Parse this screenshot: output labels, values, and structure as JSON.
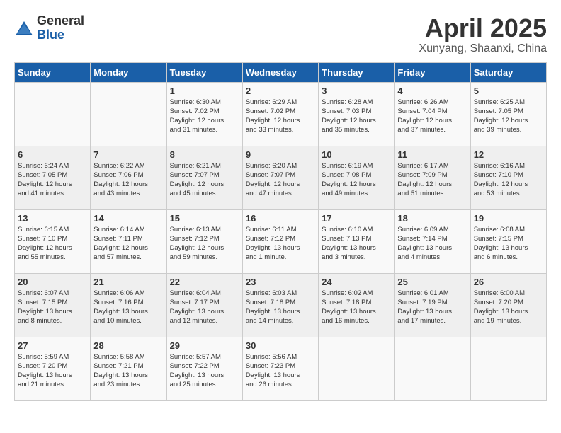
{
  "header": {
    "logo_general": "General",
    "logo_blue": "Blue",
    "month_title": "April 2025",
    "location": "Xunyang, Shaanxi, China"
  },
  "weekdays": [
    "Sunday",
    "Monday",
    "Tuesday",
    "Wednesday",
    "Thursday",
    "Friday",
    "Saturday"
  ],
  "weeks": [
    [
      {
        "day": "",
        "info": ""
      },
      {
        "day": "",
        "info": ""
      },
      {
        "day": "1",
        "info": "Sunrise: 6:30 AM\nSunset: 7:02 PM\nDaylight: 12 hours\nand 31 minutes."
      },
      {
        "day": "2",
        "info": "Sunrise: 6:29 AM\nSunset: 7:02 PM\nDaylight: 12 hours\nand 33 minutes."
      },
      {
        "day": "3",
        "info": "Sunrise: 6:28 AM\nSunset: 7:03 PM\nDaylight: 12 hours\nand 35 minutes."
      },
      {
        "day": "4",
        "info": "Sunrise: 6:26 AM\nSunset: 7:04 PM\nDaylight: 12 hours\nand 37 minutes."
      },
      {
        "day": "5",
        "info": "Sunrise: 6:25 AM\nSunset: 7:05 PM\nDaylight: 12 hours\nand 39 minutes."
      }
    ],
    [
      {
        "day": "6",
        "info": "Sunrise: 6:24 AM\nSunset: 7:05 PM\nDaylight: 12 hours\nand 41 minutes."
      },
      {
        "day": "7",
        "info": "Sunrise: 6:22 AM\nSunset: 7:06 PM\nDaylight: 12 hours\nand 43 minutes."
      },
      {
        "day": "8",
        "info": "Sunrise: 6:21 AM\nSunset: 7:07 PM\nDaylight: 12 hours\nand 45 minutes."
      },
      {
        "day": "9",
        "info": "Sunrise: 6:20 AM\nSunset: 7:07 PM\nDaylight: 12 hours\nand 47 minutes."
      },
      {
        "day": "10",
        "info": "Sunrise: 6:19 AM\nSunset: 7:08 PM\nDaylight: 12 hours\nand 49 minutes."
      },
      {
        "day": "11",
        "info": "Sunrise: 6:17 AM\nSunset: 7:09 PM\nDaylight: 12 hours\nand 51 minutes."
      },
      {
        "day": "12",
        "info": "Sunrise: 6:16 AM\nSunset: 7:10 PM\nDaylight: 12 hours\nand 53 minutes."
      }
    ],
    [
      {
        "day": "13",
        "info": "Sunrise: 6:15 AM\nSunset: 7:10 PM\nDaylight: 12 hours\nand 55 minutes."
      },
      {
        "day": "14",
        "info": "Sunrise: 6:14 AM\nSunset: 7:11 PM\nDaylight: 12 hours\nand 57 minutes."
      },
      {
        "day": "15",
        "info": "Sunrise: 6:13 AM\nSunset: 7:12 PM\nDaylight: 12 hours\nand 59 minutes."
      },
      {
        "day": "16",
        "info": "Sunrise: 6:11 AM\nSunset: 7:12 PM\nDaylight: 13 hours\nand 1 minute."
      },
      {
        "day": "17",
        "info": "Sunrise: 6:10 AM\nSunset: 7:13 PM\nDaylight: 13 hours\nand 3 minutes."
      },
      {
        "day": "18",
        "info": "Sunrise: 6:09 AM\nSunset: 7:14 PM\nDaylight: 13 hours\nand 4 minutes."
      },
      {
        "day": "19",
        "info": "Sunrise: 6:08 AM\nSunset: 7:15 PM\nDaylight: 13 hours\nand 6 minutes."
      }
    ],
    [
      {
        "day": "20",
        "info": "Sunrise: 6:07 AM\nSunset: 7:15 PM\nDaylight: 13 hours\nand 8 minutes."
      },
      {
        "day": "21",
        "info": "Sunrise: 6:06 AM\nSunset: 7:16 PM\nDaylight: 13 hours\nand 10 minutes."
      },
      {
        "day": "22",
        "info": "Sunrise: 6:04 AM\nSunset: 7:17 PM\nDaylight: 13 hours\nand 12 minutes."
      },
      {
        "day": "23",
        "info": "Sunrise: 6:03 AM\nSunset: 7:18 PM\nDaylight: 13 hours\nand 14 minutes."
      },
      {
        "day": "24",
        "info": "Sunrise: 6:02 AM\nSunset: 7:18 PM\nDaylight: 13 hours\nand 16 minutes."
      },
      {
        "day": "25",
        "info": "Sunrise: 6:01 AM\nSunset: 7:19 PM\nDaylight: 13 hours\nand 17 minutes."
      },
      {
        "day": "26",
        "info": "Sunrise: 6:00 AM\nSunset: 7:20 PM\nDaylight: 13 hours\nand 19 minutes."
      }
    ],
    [
      {
        "day": "27",
        "info": "Sunrise: 5:59 AM\nSunset: 7:20 PM\nDaylight: 13 hours\nand 21 minutes."
      },
      {
        "day": "28",
        "info": "Sunrise: 5:58 AM\nSunset: 7:21 PM\nDaylight: 13 hours\nand 23 minutes."
      },
      {
        "day": "29",
        "info": "Sunrise: 5:57 AM\nSunset: 7:22 PM\nDaylight: 13 hours\nand 25 minutes."
      },
      {
        "day": "30",
        "info": "Sunrise: 5:56 AM\nSunset: 7:23 PM\nDaylight: 13 hours\nand 26 minutes."
      },
      {
        "day": "",
        "info": ""
      },
      {
        "day": "",
        "info": ""
      },
      {
        "day": "",
        "info": ""
      }
    ]
  ]
}
